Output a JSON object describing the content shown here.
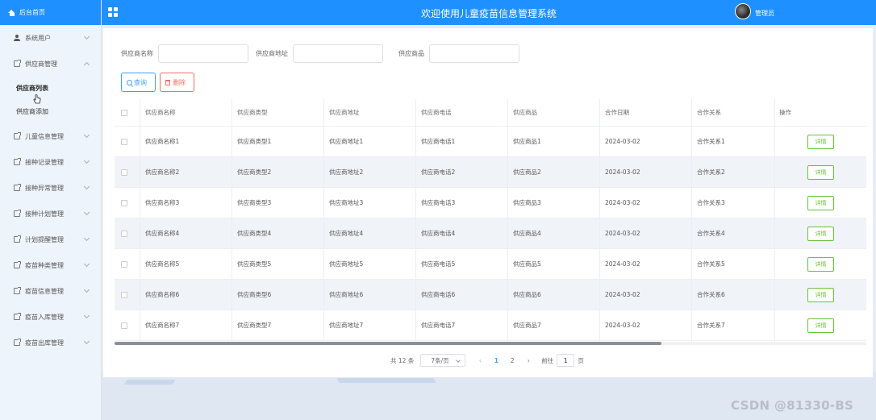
{
  "header": {
    "title": "欢迎使用儿童疫苗信息管理系统",
    "user": "管理员"
  },
  "sidebar": {
    "home": "后台首页",
    "items": [
      {
        "label": "系统用户",
        "icon": "user-icon",
        "expanded": false
      },
      {
        "label": "供应商管理",
        "icon": "document-icon",
        "expanded": true,
        "children": [
          "供应商列表",
          "供应商添加"
        ],
        "active_child": "供应商列表"
      },
      {
        "label": "儿童信息管理",
        "icon": "document-icon"
      },
      {
        "label": "接种记录管理",
        "icon": "document-icon"
      },
      {
        "label": "接种异常管理",
        "icon": "document-icon"
      },
      {
        "label": "接种计划管理",
        "icon": "document-icon"
      },
      {
        "label": "计划提醒管理",
        "icon": "document-icon"
      },
      {
        "label": "疫苗种类管理",
        "icon": "document-icon"
      },
      {
        "label": "疫苗信息管理",
        "icon": "document-icon"
      },
      {
        "label": "疫苗入库管理",
        "icon": "document-icon"
      },
      {
        "label": "疫苗出库管理",
        "icon": "document-icon"
      }
    ]
  },
  "search": {
    "name_label": "供应商名称",
    "name_value": "",
    "address_label": "供应商地址",
    "address_value": "",
    "product_label": "供应商品",
    "product_value": "",
    "query_button": "查询",
    "delete_button": "删除"
  },
  "table": {
    "columns": [
      "供应商名称",
      "供应商类型",
      "供应商地址",
      "供应商电话",
      "供应商品",
      "合作日期",
      "合作关系",
      "操作"
    ],
    "rows": [
      [
        "供应商名称1",
        "供应商类型1",
        "供应商地址1",
        "供应商电话1",
        "供应商品1",
        "2024-03-02",
        "合作关系1"
      ],
      [
        "供应商名称2",
        "供应商类型2",
        "供应商地址2",
        "供应商电话2",
        "供应商品2",
        "2024-03-02",
        "合作关系2"
      ],
      [
        "供应商名称3",
        "供应商类型3",
        "供应商地址3",
        "供应商电话3",
        "供应商品3",
        "2024-03-02",
        "合作关系3"
      ],
      [
        "供应商名称4",
        "供应商类型4",
        "供应商地址4",
        "供应商电话4",
        "供应商品4",
        "2024-03-02",
        "合作关系4"
      ],
      [
        "供应商名称5",
        "供应商类型5",
        "供应商地址5",
        "供应商电话5",
        "供应商品5",
        "2024-03-02",
        "合作关系5"
      ],
      [
        "供应商名称6",
        "供应商类型6",
        "供应商地址6",
        "供应商电话6",
        "供应商品6",
        "2024-03-02",
        "合作关系6"
      ],
      [
        "供应商名称7",
        "供应商类型7",
        "供应商地址7",
        "供应商电话7",
        "供应商品7",
        "2024-03-02",
        "合作关系7"
      ]
    ],
    "action_label": "详情"
  },
  "pagination": {
    "total_text": "共 12 条",
    "page_size": "7条/页",
    "pages": [
      "1",
      "2"
    ],
    "current_page": "1",
    "goto_label": "前往",
    "goto_value": "1",
    "page_unit": "页"
  },
  "watermark": "CSDN @81330-BS",
  "colors": {
    "primary": "#1e90ff",
    "query": "#409eff",
    "delete": "#f56c6c",
    "detail": "#67c23a"
  }
}
